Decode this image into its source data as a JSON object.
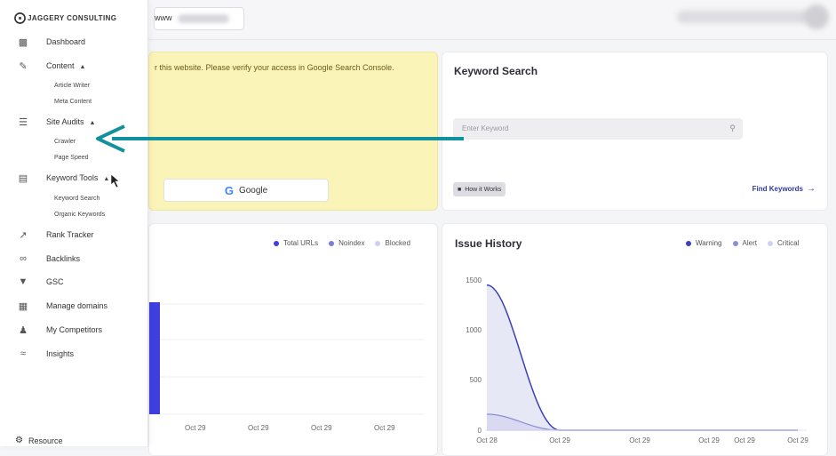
{
  "brand": {
    "name": "JAGGERY CONSULTING"
  },
  "topbar": {
    "domain_prefix": "www"
  },
  "sidebar": {
    "items": [
      {
        "label": "Dashboard",
        "icon": "bar-chart-icon"
      },
      {
        "label": "Content",
        "icon": "pencil-icon",
        "expanded": true,
        "children": [
          "Article Writer",
          "Meta Content"
        ]
      },
      {
        "label": "Site Audits",
        "icon": "layers-icon",
        "expanded": true,
        "children": [
          "Crawler",
          "Page Speed"
        ]
      },
      {
        "label": "Keyword Tools",
        "icon": "keyword-icon",
        "expanded": true,
        "children": [
          "Keyword Search",
          "Organic Keywords"
        ]
      },
      {
        "label": "Rank Tracker",
        "icon": "rank-icon"
      },
      {
        "label": "Backlinks",
        "icon": "link-icon"
      },
      {
        "label": "GSC",
        "icon": "gsc-icon"
      },
      {
        "label": "Manage domains",
        "icon": "building-icon"
      },
      {
        "label": "My Competitors",
        "icon": "people-icon"
      },
      {
        "label": "Insights",
        "icon": "insights-icon"
      }
    ],
    "resource_label": "Resource"
  },
  "gsc_card": {
    "message": "r this website. Please verify your access in Google Search Console.",
    "google_button": "Google"
  },
  "keyword_card": {
    "title": "Keyword Search",
    "input_placeholder": "Enter Keyword",
    "how_it_works": "How it Works",
    "find_keywords": "Find Keywords"
  },
  "crawl_chart": {
    "legend": [
      "Total URLs",
      "Noindex",
      "Blocked"
    ],
    "x_labels": [
      "Oct 29",
      "Oct 29",
      "Oct 29",
      "Oct 29"
    ]
  },
  "issue_history": {
    "title": "Issue History",
    "legend": [
      "Warning",
      "Alert",
      "Critical"
    ],
    "y_ticks": [
      "1500",
      "1000",
      "500",
      "0"
    ],
    "x_labels": [
      "Oct 28",
      "Oct 29",
      "Oct 29",
      "Oct 29",
      "Oct 29",
      "Oct 29"
    ]
  },
  "colors": {
    "total_urls": "#3f3fe0",
    "noindex": "#7b7fd8",
    "blocked": "#cdd0f0",
    "warning": "#3b41b8",
    "alert": "#8a8fd6",
    "critical": "#cfd1f2",
    "arrow": "#11909e",
    "gsc_bg": "#fbf4b8"
  },
  "chart_data": [
    {
      "type": "bar",
      "categories": [
        "Oct 29",
        "Oct 29",
        "Oct 29",
        "Oct 29"
      ],
      "series": [
        {
          "name": "Total URLs",
          "values": [
            1,
            0,
            0,
            0
          ]
        },
        {
          "name": "Noindex",
          "values": [
            0,
            0,
            0,
            0
          ]
        },
        {
          "name": "Blocked",
          "values": [
            0,
            0,
            0,
            0
          ]
        }
      ],
      "legend": "top-right"
    },
    {
      "type": "area",
      "title": "Issue History",
      "x": [
        "Oct 28",
        "Oct 29",
        "Oct 29",
        "Oct 29",
        "Oct 29",
        "Oct 29"
      ],
      "series": [
        {
          "name": "Warning",
          "values": [
            1450,
            0,
            0,
            0,
            0,
            0
          ]
        },
        {
          "name": "Alert",
          "values": [
            160,
            0,
            0,
            0,
            0,
            0
          ]
        },
        {
          "name": "Critical",
          "values": [
            0,
            0,
            0,
            0,
            0,
            0
          ]
        }
      ],
      "ylim": [
        0,
        1500
      ],
      "grid": false,
      "legend": "top-right"
    }
  ]
}
